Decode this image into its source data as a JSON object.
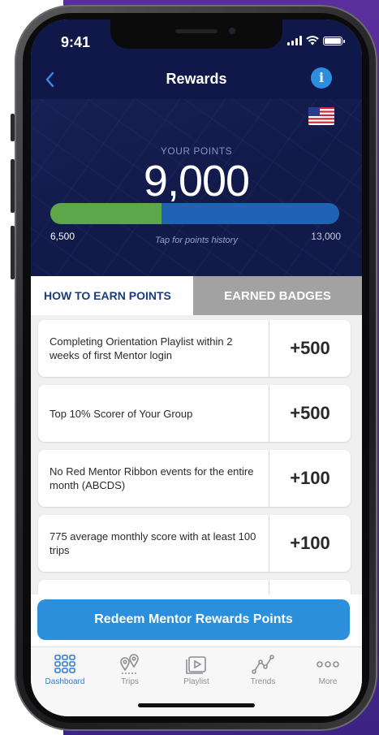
{
  "status_bar": {
    "time": "9:41"
  },
  "nav": {
    "title": "Rewards",
    "info_icon": "i"
  },
  "points": {
    "label": "YOUR POINTS",
    "value": "9,000",
    "range_min": "6,500",
    "range_max": "13,000",
    "history_link": "Tap for points history",
    "progress_fraction": 0.385
  },
  "tabs": {
    "earn": "HOW TO EARN POINTS",
    "badges": "EARNED BADGES"
  },
  "rewards": [
    {
      "text": "Completing Orientation Playlist within 2 weeks of first Mentor login",
      "points": "+500"
    },
    {
      "text": "Top 10% Scorer of Your Group",
      "points": "+500"
    },
    {
      "text": "No Red Mentor Ribbon events for the entire month (ABCDS)",
      "points": "+100"
    },
    {
      "text": "775 average monthly score with at least 100 trips",
      "points": "+100"
    }
  ],
  "redeem_button": "Redeem Mentor Rewards Points",
  "tabbar": {
    "items": [
      {
        "label": "Dashboard",
        "icon": "dashboard-grid-icon"
      },
      {
        "label": "Trips",
        "icon": "map-pins-icon"
      },
      {
        "label": "Playlist",
        "icon": "play-icon"
      },
      {
        "label": "Trends",
        "icon": "trend-line-icon"
      },
      {
        "label": "More",
        "icon": "more-dots-icon"
      }
    ]
  },
  "colors": {
    "header_bg": "#121a4a",
    "progress_green": "#5ea64a",
    "progress_blue": "#1f63b4",
    "accent_blue": "#2b8fdc",
    "purple_bg": "#4b2a92"
  }
}
